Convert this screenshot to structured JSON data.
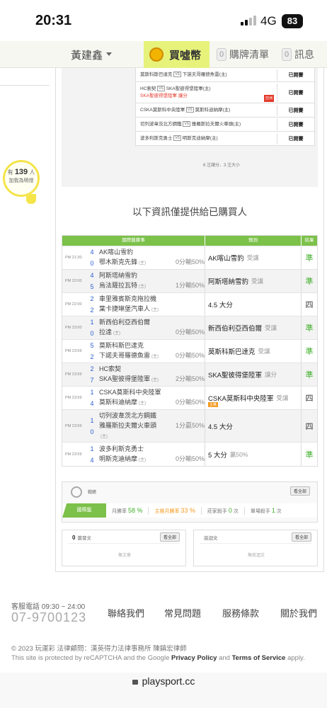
{
  "status_bar": {
    "time": "20:31",
    "network": "4G",
    "battery": "83"
  },
  "nav": {
    "user": "黃建鑫",
    "buy_label": "買噓幣",
    "cart_count": "0",
    "cart_label": "購牌清單",
    "msg_count": "0",
    "msg_label": "訊息"
  },
  "left_widget": {
    "prefix": "有",
    "count": "139",
    "suffix": "人",
    "caption": "加我為明燈"
  },
  "top_table": {
    "rows": [
      {
        "team1": "莫斯科斯巴達克",
        "team2": "下諾夫哥羅德魚雷(主)",
        "pick": "",
        "tag": "",
        "status": "已開賽"
      },
      {
        "team1": "HC索契",
        "team2": "SKA聖彼得堡陸軍(主)",
        "pick": "SKA聖彼得堡陸軍  讓分",
        "tag": "亞洲",
        "status": "已開賽"
      },
      {
        "team1": "CSKA莫斯科中央陸軍",
        "team2": "莫斯科迪納摩(主)",
        "pick": "",
        "tag": "",
        "status": "已開賽"
      },
      {
        "team1": "切列波韋茨北方鋼鐵",
        "team2": "雅羅斯拉夫爾火車頭(主)",
        "pick": "",
        "tag": "",
        "status": "已開賽"
      },
      {
        "team1": "波多利斯克勇士",
        "team2": "明斯克迪納摩(主)",
        "pick": "",
        "tag": "",
        "status": "已開賽"
      }
    ],
    "vs": "VS",
    "footnote": "6 注讓分．3 注大小"
  },
  "notice": "以下資訊僅提供給已購買人",
  "pred_table": {
    "headers": [
      "國際盤賽事",
      "預測",
      "結果"
    ],
    "rows": [
      {
        "time": "PM 21:30",
        "s1": "4",
        "s2": "0",
        "t1": "AK喀山雪豹",
        "t2": "鄂木斯克先鋒",
        "home": "(主)",
        "odds": "0分輸50%",
        "oddsline": 2,
        "pick": "AK喀山雪豹",
        "sub": "受讓",
        "badge": "",
        "result": "準",
        "win": true
      },
      {
        "time": "PM 22:00",
        "s1": "4",
        "s2": "5",
        "t1": "阿斯塔納雪豹",
        "t2": "烏法薩拉瓦特",
        "home": "(主)",
        "odds": "1分輸50%",
        "oddsline": 2,
        "pick": "阿斯塔納雪豹",
        "sub": "受讓",
        "badge": "",
        "result": "準",
        "win": true
      },
      {
        "time": "PM 22:00",
        "s1": "2",
        "s2": "2",
        "t1": "車里雅賓斯克拖拉機",
        "t2": "葉卡捷琳堡汽車人",
        "home": "(主)",
        "odds": "",
        "oddsline": 0,
        "pick": "4.5 大分",
        "sub": "",
        "badge": "",
        "result": "四",
        "win": false
      },
      {
        "time": "PM 23:00",
        "s1": "1",
        "s2": "0",
        "t1": "新西伯利亞西伯爾",
        "t2": "拉達",
        "home": "(主)",
        "odds": "0分輸50%",
        "oddsline": 2,
        "pick": "新西伯利亞西伯爾",
        "sub": "受讓",
        "badge": "",
        "result": "準",
        "win": true
      },
      {
        "time": "PM 23:59",
        "s1": "5",
        "s2": "2",
        "t1": "莫斯科斯巴達克",
        "t2": "下諾夫哥羅德魚雷",
        "home": "(主)",
        "odds": "0分輸50%",
        "oddsline": 2,
        "pick": "莫斯科斯巴達克",
        "sub": "受讓",
        "badge": "",
        "result": "準",
        "win": true
      },
      {
        "time": "PM 23:59",
        "s1": "2",
        "s2": "7",
        "t1": "HC索契",
        "t2": "SKA聖彼得堡陸軍",
        "home": "(主)",
        "odds": "2分輸50%",
        "oddsline": 2,
        "pick": "SKA聖彼得堡陸軍",
        "sub": "讓分",
        "badge": "",
        "result": "準",
        "win": true
      },
      {
        "time": "PM 23:59",
        "s1": "1",
        "s2": "4",
        "t1": "CSKA莫斯科中央陸軍",
        "t2": "莫斯科迪納摩",
        "home": "(主)",
        "odds": "0分輸50%",
        "oddsline": 2,
        "pick": "CSKA莫斯科中央陸軍",
        "sub": "受讓",
        "badge": "主推",
        "result": "四",
        "win": false
      },
      {
        "time": "PM 23:59",
        "s1": "1",
        "s2": "0",
        "t1": "切列波韋茨北方鋼鐵",
        "t2": "雅羅斯拉夫爾火車頭",
        "home": "(主)",
        "odds": "1分贏50%",
        "oddsline": 2,
        "pick": "4.5 大分",
        "sub": "",
        "badge": "",
        "result": "四",
        "win": false
      },
      {
        "time": "PM 23:59",
        "s1": "1",
        "s2": "4",
        "t1": "波多利斯克勇士",
        "t2": "明斯克迪納摩",
        "home": "(主)",
        "odds": "0分輸50%",
        "oddsline": 2,
        "pick": "5 大分",
        "sub": "贏50%",
        "badge": "",
        "result": "準",
        "win": true
      }
    ]
  },
  "stats": {
    "label": "戰績",
    "view_all": "看全部",
    "tab": "國際盤",
    "items": [
      {
        "label": "月勝率",
        "value": "58 %",
        "color": "#3fae2a"
      },
      {
        "label": "主推月勝率",
        "value": "33 %",
        "color": "#f39a1e"
      },
      {
        "label": "莊家殺手",
        "value": "0",
        "suffix": "次",
        "color": "#3fae2a"
      },
      {
        "label": "單場殺手",
        "value": "1",
        "suffix": "次",
        "color": "#3fae2a"
      }
    ]
  },
  "posts": {
    "count": "0",
    "label": "篇發文",
    "view_all": "看全部",
    "empty": "無文章"
  },
  "replies": {
    "label": "底迴文",
    "view_all": "看全部",
    "empty": "無底迴文"
  },
  "footer": {
    "service": "客服電話 09:30 ~ 24:00",
    "phone": "07-9700123",
    "links": [
      "聯絡我們",
      "常見問題",
      "服務條款",
      "關於我們"
    ],
    "copyright": "© 2023 玩運彩  法律顧問：漢英得力法律事務所 陳鎮宏律師",
    "recaptcha_pre": "This site is protected by reCAPTCHA and the Google ",
    "privacy": "Privacy Policy",
    "and": " and ",
    "terms": "Terms of Service",
    "apply": " apply."
  },
  "url": "playsport.cc"
}
